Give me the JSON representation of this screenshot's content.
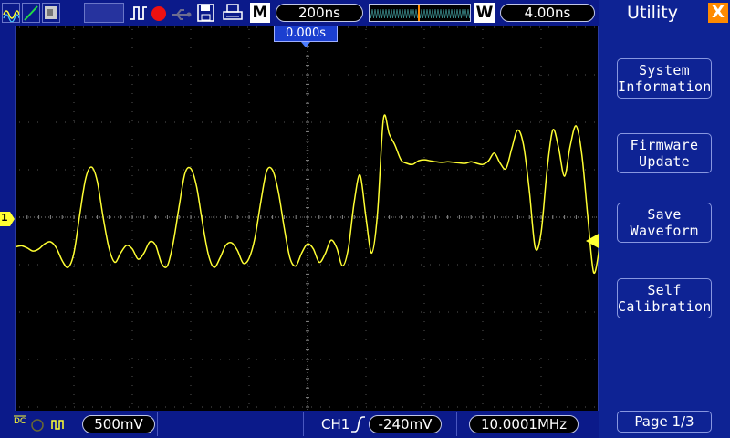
{
  "status_bar": {
    "timebase": "200ns",
    "mode_main": "M",
    "mode_window": "W",
    "window_timebase": "4.00ns",
    "trigger_position": "0.000s",
    "run_state_color": "#ee1111"
  },
  "channel": {
    "marker": "1",
    "volts_per_div": "500mV",
    "coupling_icon": "dc-coupling-icon"
  },
  "trigger": {
    "source": "CH1",
    "edge_icon": "rising-edge-icon",
    "level": "-240mV",
    "frequency": "10.0001MHz"
  },
  "menu": {
    "title": "Utility",
    "close_label": "X",
    "buttons": [
      {
        "line1": "System",
        "line2": "Information"
      },
      {
        "line1": "Firmware",
        "line2": "Update"
      },
      {
        "line1": "Save",
        "line2": "Waveform"
      },
      {
        "line1": "Self",
        "line2": "Calibration"
      }
    ],
    "page": "Page 1/3"
  },
  "colors": {
    "trace": "#ffff33",
    "bar_bg": "#0b1a8a",
    "menu_bg": "#0e2394",
    "accent_close": "#ff8a00"
  },
  "waveform": {
    "description_free": true,
    "samples": [
      -0.58,
      -0.56,
      -0.6,
      -0.66,
      -0.62,
      -0.52,
      -0.48,
      -0.6,
      -0.85,
      -0.98,
      -0.7,
      0.05,
      0.75,
      0.98,
      0.7,
      0.0,
      -0.6,
      -0.88,
      -0.7,
      -0.55,
      -0.62,
      -0.82,
      -0.7,
      -0.48,
      -0.55,
      -0.9,
      -0.95,
      -0.5,
      0.2,
      0.85,
      0.95,
      0.6,
      -0.1,
      -0.72,
      -0.98,
      -0.8,
      -0.55,
      -0.5,
      -0.65,
      -0.9,
      -0.8,
      -0.4,
      0.3,
      0.9,
      0.92,
      0.5,
      -0.2,
      -0.8,
      -0.95,
      -0.7,
      -0.52,
      -0.62,
      -0.88,
      -0.72,
      -0.45,
      -0.6,
      -0.95,
      -0.6,
      0.3,
      0.82,
      0.0,
      -0.7,
      0.1,
      1.92,
      1.62,
      1.4,
      1.12,
      1.05,
      1.03,
      1.1,
      1.12,
      1.1,
      1.08,
      1.07,
      1.08,
      1.07,
      1.06,
      1.05,
      1.08,
      1.05,
      1.03,
      1.1,
      1.25,
      1.05,
      0.95,
      1.35,
      1.7,
      1.4,
      0.5,
      -0.6,
      -0.3,
      0.9,
      1.7,
      1.35,
      0.8,
      1.4,
      1.78,
      1.2,
      0.0,
      -1.08,
      -0.6
    ]
  }
}
